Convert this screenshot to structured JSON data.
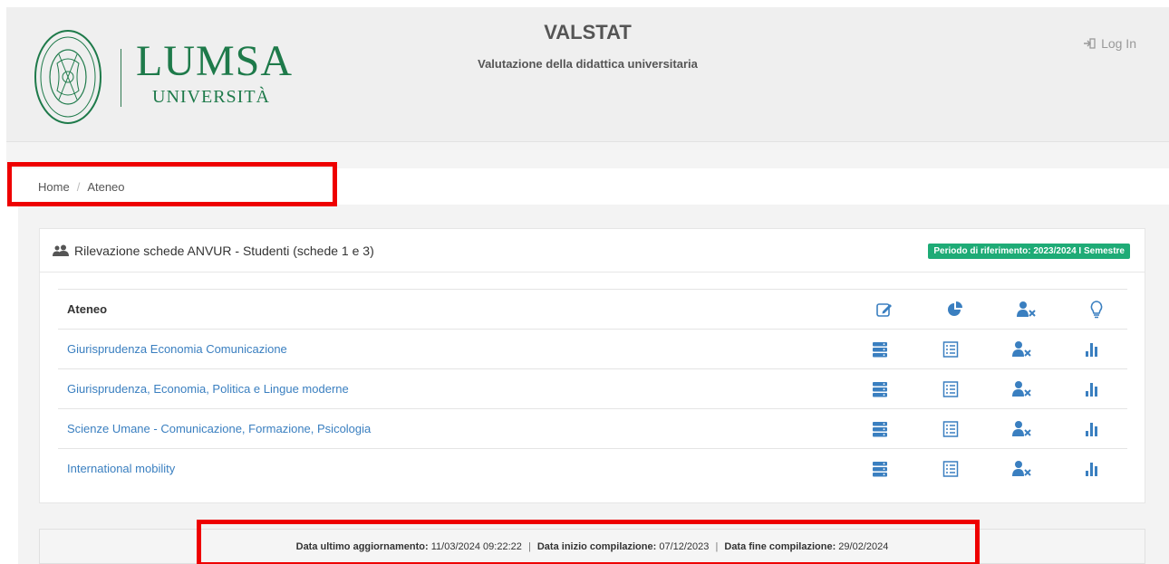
{
  "header": {
    "logo_word": "LUMSA",
    "logo_sub": "UNIVERSITÀ",
    "app_title": "VALSTAT",
    "app_subtitle": "Valutazione della didattica universitaria",
    "login_label": "Log In"
  },
  "breadcrumb": {
    "home": "Home",
    "separator": "/",
    "current": "Ateneo"
  },
  "panel": {
    "title": "Rilevazione schede ANVUR - Studenti (schede 1 e 3)",
    "badge": "Periodo di riferimento: 2023/2024 I Semestre",
    "header_label": "Ateneo",
    "header_icons": [
      "edit-icon",
      "pie-chart-icon",
      "user-remove-icon",
      "lightbulb-icon"
    ],
    "row_icons": [
      "database-icon",
      "list-icon",
      "user-remove-icon",
      "bar-chart-icon"
    ],
    "rows": [
      {
        "name": "Giurisprudenza Economia Comunicazione"
      },
      {
        "name": "Giurisprudenza, Economia, Politica e Lingue moderne"
      },
      {
        "name": "Scienze Umane - Comunicazione, Formazione, Psicologia"
      },
      {
        "name": "International mobility"
      }
    ]
  },
  "footer": {
    "last_update_label": "Data ultimo aggiornamento:",
    "last_update_value": "11/03/2024 09:22:22",
    "start_label": "Data inizio compilazione:",
    "start_value": "07/12/2023",
    "end_label": "Data fine compilazione:",
    "end_value": "29/02/2024",
    "separator": "|"
  },
  "colors": {
    "brand_green": "#1e7a4a",
    "badge_green": "#1eab76",
    "icon_blue": "#3a7fc0",
    "highlight_red": "#ee0000"
  }
}
